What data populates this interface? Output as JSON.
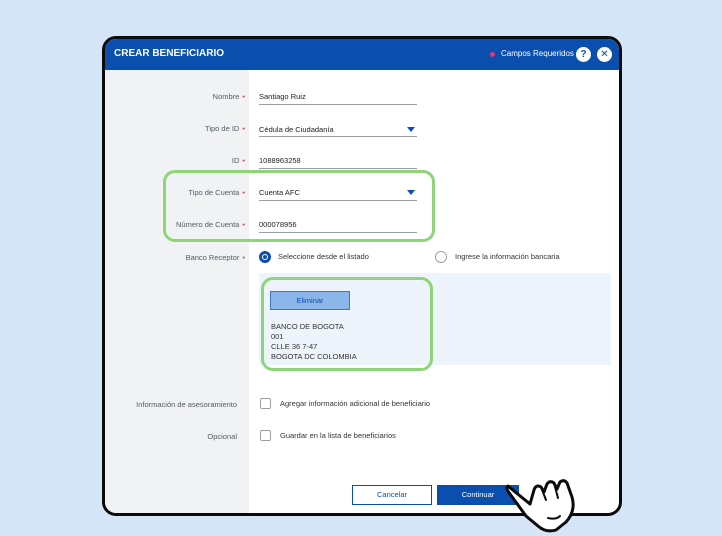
{
  "dialog": {
    "title": "CREAR BENEFICIARIO",
    "required_note": "Campos Requeridos",
    "help_glyph": "?",
    "close_glyph": "✕"
  },
  "form": {
    "required_mark": "•",
    "nombre": {
      "label": "Nombre",
      "value": "Santiago Ruiz"
    },
    "tipo_id": {
      "label": "Tipo de ID",
      "value": "Cédula de Ciudadanía"
    },
    "id": {
      "label": "ID",
      "value": "1088963258"
    },
    "tipo_cuenta": {
      "label": "Tipo de Cuenta",
      "value": "Cuenta AFC"
    },
    "numero_cuenta": {
      "label": "Número de Cuenta",
      "value": "000078956"
    },
    "banco_receptor": {
      "label": "Banco Receptor",
      "options": [
        {
          "label": "Seleccione desde el listado",
          "selected": true
        },
        {
          "label": "Ingrese la información bancaria",
          "selected": false
        }
      ]
    },
    "bank": {
      "eliminar_label": "Eliminar",
      "lines": [
        "BANCO DE BOGOTA",
        "001",
        "CLLE 36 7-47",
        "BOGOTA DC COLOMBIA"
      ]
    },
    "asesoramiento": {
      "label": "Información de asesoramiento",
      "checkbox_label": "Agregar información adicional de beneficiario",
      "checked": false
    },
    "opcional": {
      "label": "Opcional",
      "checkbox_label": "Guardar en la lista de beneficiarios",
      "checked": false
    }
  },
  "actions": {
    "cancel_label": "Cancelar",
    "continue_label": "Continuar"
  },
  "colors": {
    "primary": "#0a4fae",
    "required": "#e8346f",
    "highlight": "#8fd47a",
    "background": "#d5e5f7"
  }
}
